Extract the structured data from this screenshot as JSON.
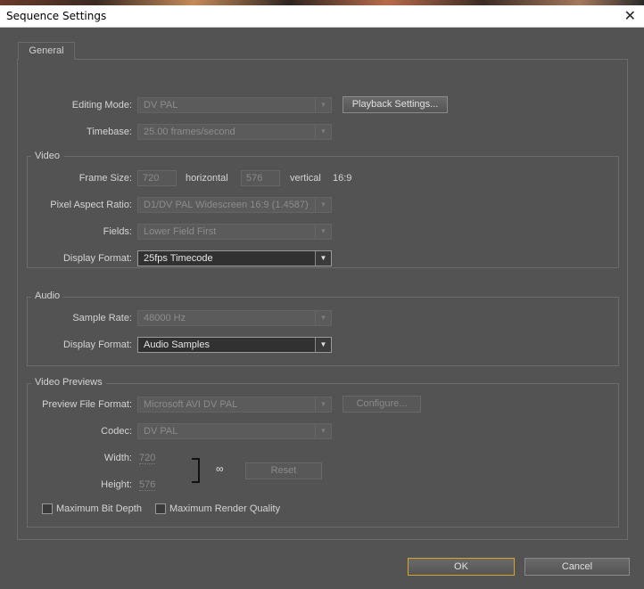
{
  "window": {
    "title": "Sequence Settings",
    "close_glyph": "✕"
  },
  "tabs": [
    {
      "label": "General"
    }
  ],
  "general": {
    "editing_mode": {
      "label": "Editing Mode:",
      "value": "DV PAL"
    },
    "playback_settings_label": "Playback Settings...",
    "timebase": {
      "label": "Timebase:",
      "value": "25.00 frames/second"
    }
  },
  "video": {
    "title": "Video",
    "frame_size": {
      "label": "Frame Size:",
      "width": "720",
      "horizontal_label": "horizontal",
      "height": "576",
      "vertical_label": "vertical",
      "aspect": "16:9"
    },
    "pixel_aspect": {
      "label": "Pixel Aspect Ratio:",
      "value": "D1/DV PAL Widescreen 16:9 (1.4587)"
    },
    "fields": {
      "label": "Fields:",
      "value": "Lower Field First"
    },
    "display_format": {
      "label": "Display Format:",
      "value": "25fps Timecode"
    }
  },
  "audio": {
    "title": "Audio",
    "sample_rate": {
      "label": "Sample Rate:",
      "value": "48000 Hz"
    },
    "display_format": {
      "label": "Display Format:",
      "value": "Audio Samples"
    }
  },
  "previews": {
    "title": "Video Previews",
    "file_format": {
      "label": "Preview File Format:",
      "value": "Microsoft AVI DV PAL"
    },
    "configure_label": "Configure...",
    "codec": {
      "label": "Codec:",
      "value": "DV PAL"
    },
    "width": {
      "label": "Width:",
      "value": "720"
    },
    "height": {
      "label": "Height:",
      "value": "576"
    },
    "reset_label": "Reset",
    "max_bit_depth_label": "Maximum Bit Depth",
    "max_render_quality_label": "Maximum Render Quality"
  },
  "footer": {
    "ok_label": "OK",
    "cancel_label": "Cancel"
  },
  "icons": {
    "dropdown": "▼",
    "link": "∞"
  },
  "colors": {
    "accent_focus": "#d8a62a",
    "dialog_bg": "#535353"
  }
}
